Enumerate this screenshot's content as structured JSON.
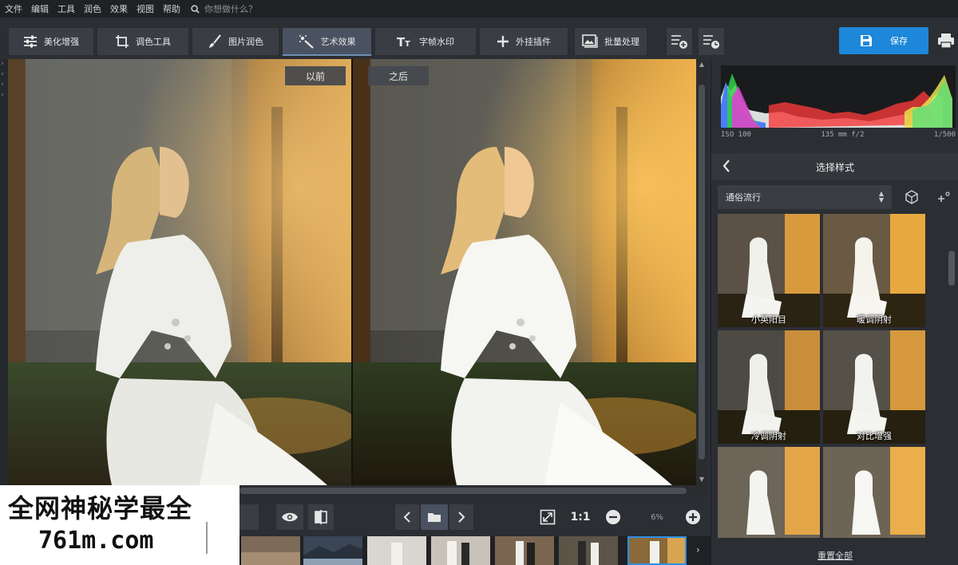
{
  "menu": {
    "items": [
      "文件",
      "编辑",
      "工具",
      "润色",
      "效果",
      "视图",
      "帮助"
    ],
    "search_placeholder": "你想做什么？"
  },
  "toolbar": {
    "tools": [
      {
        "label": "美化增强",
        "icon": "sliders-icon"
      },
      {
        "label": "调色工具",
        "icon": "crop-icon"
      },
      {
        "label": "图片润色",
        "icon": "brush-icon"
      },
      {
        "label": "艺术效果",
        "icon": "magic-wand-icon",
        "active": true
      },
      {
        "label": "字帧水印",
        "icon": "text-icon"
      },
      {
        "label": "外挂插件",
        "icon": "plus-icon"
      },
      {
        "label": "批量处理",
        "icon": "images-icon"
      }
    ],
    "save_label": "保存"
  },
  "compare": {
    "before_label": "以前",
    "after_label": "之后"
  },
  "view": {
    "zoom_ratio": "1:1",
    "zoom_percent": "6%"
  },
  "right_panel": {
    "histogram_info": {
      "iso": "ISO 100",
      "lens": "135 mm f/2",
      "shutter": "1/500"
    },
    "header": "选择样式",
    "category": "通俗流行",
    "styles": [
      {
        "label": "小英阳目"
      },
      {
        "label": "暖调阴射"
      },
      {
        "label": "冷调阴射"
      },
      {
        "label": "对比增强"
      },
      {
        "label": ""
      },
      {
        "label": ""
      }
    ],
    "reset_label": "重置全部"
  },
  "watermark": {
    "line1": "全网神秘学最全",
    "line2": "761m.com"
  },
  "colors": {
    "accent": "#1d87d9",
    "selection": "#2f8fe0",
    "panel": "#2b2e33",
    "button": "#3a3e44"
  }
}
